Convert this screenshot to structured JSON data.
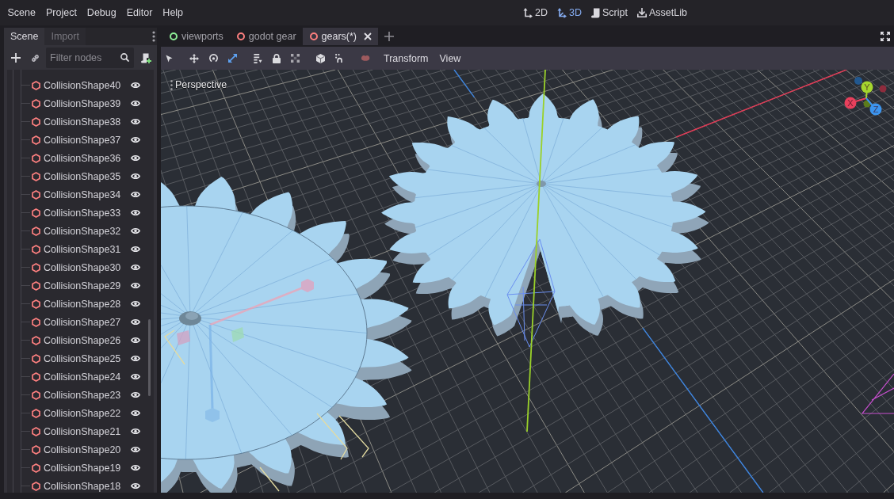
{
  "menu_bar": {
    "menus": [
      "Scene",
      "Project",
      "Debug",
      "Editor",
      "Help"
    ],
    "workspaces": [
      {
        "kind": "planar",
        "label": "2D",
        "selected": false
      },
      {
        "kind": "spatial",
        "label": "3D",
        "selected": true
      },
      {
        "kind": "script",
        "label": "Script",
        "selected": false
      },
      {
        "kind": "assetlib",
        "label": "AssetLib",
        "selected": false
      }
    ]
  },
  "scene_dock": {
    "tabs": [
      {
        "label": "Scene",
        "selected": true
      },
      {
        "label": "Import",
        "selected": false
      }
    ],
    "filter": {
      "placeholder": "Filter nodes"
    },
    "tree": {
      "items": [
        {
          "label": "CollisionShape40",
          "visible": true
        },
        {
          "label": "CollisionShape39",
          "visible": true
        },
        {
          "label": "CollisionShape38",
          "visible": true
        },
        {
          "label": "CollisionShape37",
          "visible": true
        },
        {
          "label": "CollisionShape36",
          "visible": true
        },
        {
          "label": "CollisionShape35",
          "visible": true
        },
        {
          "label": "CollisionShape34",
          "visible": true
        },
        {
          "label": "CollisionShape33",
          "visible": true
        },
        {
          "label": "CollisionShape32",
          "visible": true
        },
        {
          "label": "CollisionShape31",
          "visible": true
        },
        {
          "label": "CollisionShape30",
          "visible": true
        },
        {
          "label": "CollisionShape29",
          "visible": true
        },
        {
          "label": "CollisionShape28",
          "visible": true
        },
        {
          "label": "CollisionShape27",
          "visible": true
        },
        {
          "label": "CollisionShape26",
          "visible": true
        },
        {
          "label": "CollisionShape25",
          "visible": true
        },
        {
          "label": "CollisionShape24",
          "visible": true
        },
        {
          "label": "CollisionShape23",
          "visible": true
        },
        {
          "label": "CollisionShape22",
          "visible": true
        },
        {
          "label": "CollisionShape21",
          "visible": true
        },
        {
          "label": "CollisionShape20",
          "visible": true
        },
        {
          "label": "CollisionShape19",
          "visible": true
        },
        {
          "label": "CollisionShape18",
          "visible": true
        }
      ]
    }
  },
  "editor": {
    "tabs": [
      {
        "label": "viewports",
        "color": "#8eef97",
        "selected": false
      },
      {
        "label": "godot gear",
        "color": "#fc7f7f",
        "selected": false
      },
      {
        "label": "gears(*)",
        "color": "#fc7f7f",
        "selected": true
      }
    ],
    "toolbar": {
      "tools": [
        {
          "kind": "select",
          "selected": false
        },
        {
          "kind": "move",
          "selected": false
        },
        {
          "kind": "rotate",
          "selected": false
        },
        {
          "kind": "scale",
          "selected": true
        },
        {
          "kind": "list",
          "selected": false
        },
        {
          "kind": "lock",
          "selected": false
        },
        {
          "kind": "group",
          "selected": false
        },
        {
          "kind": "cube",
          "selected": false
        },
        {
          "kind": "snap",
          "selected": false
        },
        {
          "kind": "paint",
          "selected": false
        }
      ],
      "menus": [
        "Transform",
        "View"
      ]
    },
    "viewport": {
      "view_menu": "Perspective",
      "gizmo": {
        "axes": [
          {
            "label": "X",
            "color": "#e8405c"
          },
          {
            "label": "Y",
            "color": "#a5d62e"
          },
          {
            "label": "Z",
            "color": "#3c95ee"
          }
        ]
      }
    }
  }
}
